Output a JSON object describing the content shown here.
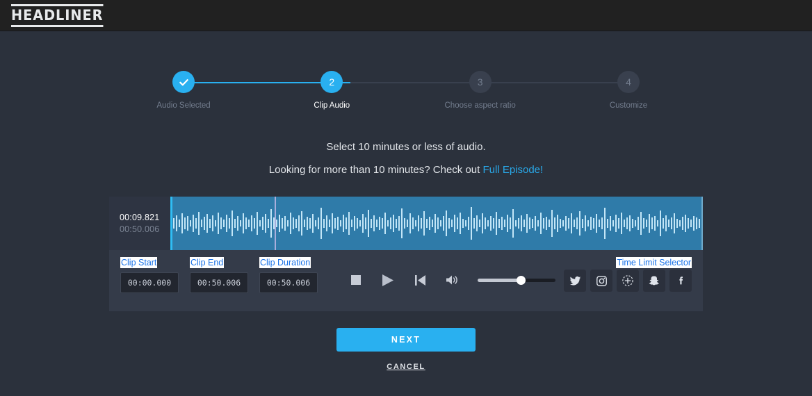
{
  "header": {
    "logo_text": "HEADLINER"
  },
  "stepper": {
    "steps": [
      {
        "marker": "✓",
        "label": "Audio Selected",
        "state": "done"
      },
      {
        "marker": "2",
        "label": "Clip Audio",
        "state": "active"
      },
      {
        "marker": "3",
        "label": "Choose aspect ratio",
        "state": "todo"
      },
      {
        "marker": "4",
        "label": "Customize",
        "state": "todo"
      }
    ]
  },
  "instructions": {
    "line1": "Select 10 minutes or less of audio.",
    "line2_prefix": "Looking for more than 10 minutes? Check out ",
    "link_text": "Full Episode!"
  },
  "editor": {
    "current_time": "00:09.821",
    "total_time": "00:50.006",
    "labels": {
      "clip_start": "Clip Start",
      "clip_end": "Clip End",
      "clip_duration": "Clip Duration",
      "time_limit_selector": "Time Limit Selector"
    },
    "fields": {
      "clip_start": "00:00.000",
      "clip_end": "00:50.006",
      "clip_duration": "00:50.006"
    },
    "transport": {
      "stop": "stop-icon",
      "play": "play-icon",
      "rewind": "skip-to-start-icon",
      "volume": "volume-icon",
      "volume_level": "55"
    },
    "socials": [
      {
        "name": "twitter-icon",
        "label": "Twitter"
      },
      {
        "name": "instagram-icon",
        "label": "Instagram"
      },
      {
        "name": "custom-duration-icon",
        "label": "Custom"
      },
      {
        "name": "snapchat-icon",
        "label": "Snapchat"
      },
      {
        "name": "facebook-icon",
        "label": "Facebook"
      }
    ]
  },
  "footer": {
    "next_label": "NEXT",
    "cancel_label": "CANCEL"
  },
  "colors": {
    "accent": "#29b0f0",
    "link": "#29a8e8",
    "panel": "#343b49",
    "body": "#2b313c",
    "header": "#212121",
    "waveform_region": "#2f7ba9",
    "waveform_line": "#bfe6f7",
    "playhead": "#a9aedc",
    "selection_highlight": "#ffffff",
    "selection_text": "#1a73e8"
  }
}
